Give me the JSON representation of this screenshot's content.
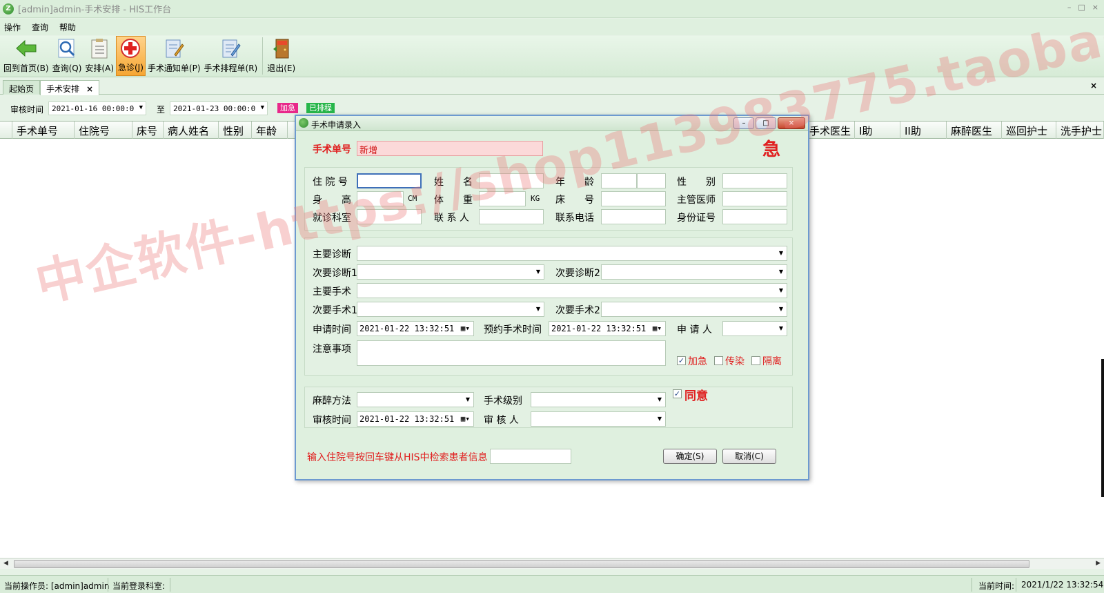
{
  "window": {
    "title": "[admin]admin-手术安排 - HIS工作台",
    "controls": [
      "–",
      "□",
      "×"
    ]
  },
  "menu": [
    "操作",
    "查询",
    "帮助"
  ],
  "toolbar": [
    {
      "label": "回到首页(B)",
      "icon": "back-arrow-icon"
    },
    {
      "label": "查询(Q)",
      "icon": "magnifier-icon"
    },
    {
      "label": "安排(A)",
      "icon": "clipboard-icon"
    },
    {
      "label": "急诊(J)",
      "icon": "emergency-cross-icon",
      "active": true
    },
    {
      "label": "手术通知单(P)",
      "icon": "notice-document-icon"
    },
    {
      "label": "手术排程单(R)",
      "icon": "schedule-document-icon"
    },
    {
      "label": "退出(E)",
      "icon": "exit-door-icon"
    }
  ],
  "tabs": [
    {
      "label": "起始页"
    },
    {
      "label": "手术安排",
      "close": "×"
    }
  ],
  "tab_close_all": "×",
  "filter": {
    "review_time_label": "审核时间",
    "from": "2021-01-16 00:00:0",
    "to_label": "至",
    "to": "2021-01-23 00:00:0",
    "urgent_chip": "加急",
    "scheduled_chip": "已排程"
  },
  "grid_columns": [
    "手术单号",
    "住院号",
    "床号",
    "病人姓名",
    "性别",
    "年龄",
    "",
    "手术医生",
    "I助",
    "II助",
    "麻醉医生",
    "巡回护士",
    "洗手护士"
  ],
  "dialog": {
    "title": "手术申请录入",
    "order_no_label": "手术单号",
    "order_no_value": "新增",
    "urgent_mark": "急",
    "patient": {
      "inpatient_no": "住 院 号",
      "name": "姓　　名",
      "age": "年　　龄",
      "sex": "性　　别",
      "height": "身　　高",
      "height_unit": "CM",
      "weight": "体　　重",
      "weight_unit": "KG",
      "bed": "床　　号",
      "doctor": "主管医师",
      "dept": "就诊科室",
      "contact": "联 系 人",
      "phone": "联系电话",
      "id_no": "身份证号"
    },
    "surgery": {
      "main_diag": "主要诊断",
      "sec_diag1": "次要诊断1",
      "sec_diag2": "次要诊断2",
      "main_surgery": "主要手术",
      "sec_surgery1": "次要手术1",
      "sec_surgery2": "次要手术2",
      "apply_time_label": "申请时间",
      "apply_time": "2021-01-22 13:32:51",
      "planned_time_label": "预约手术时间",
      "planned_time": "2021-01-22 13:32:51",
      "applicant_label": "申 请 人",
      "notes_label": "注意事项",
      "urgent": {
        "label": "加急",
        "checked": true
      },
      "infectious": {
        "label": "传染",
        "checked": false
      },
      "isolation": {
        "label": "隔离",
        "checked": false
      }
    },
    "review": {
      "anesthesia_label": "麻醉方法",
      "level_label": "手术级别",
      "agree": {
        "label": "同意",
        "checked": true
      },
      "review_time_label": "审核时间",
      "review_time": "2021-01-22 13:32:51",
      "reviewer_label": "审 核 人"
    },
    "hint": "输入住院号按回车键从HIS中检索患者信息",
    "ok": "确定(S)",
    "cancel": "取消(C)"
  },
  "watermark": "中企软件-https://shop113983775.taobao.com",
  "status": {
    "operator": "当前操作员: [admin]admin",
    "dept": "当前登录科室:",
    "time_label": "当前时间:",
    "time": "2021/1/22 13:32:54"
  }
}
